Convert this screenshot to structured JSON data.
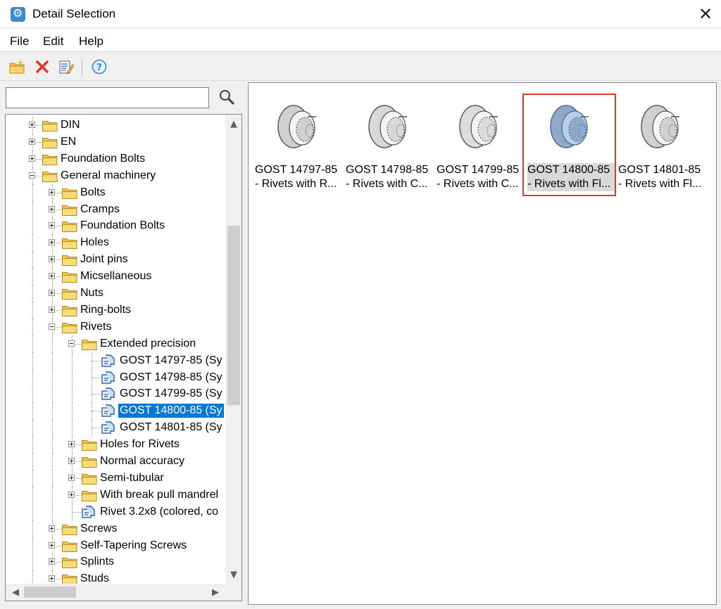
{
  "window": {
    "title": "Detail Selection"
  },
  "menu": [
    "File",
    "Edit",
    "Help"
  ],
  "toolbar": {
    "icons": [
      "new-folder-icon",
      "delete-icon",
      "edit-properties-icon",
      "help-icon"
    ],
    "colors": {
      "delete": "#d9382b",
      "help": "#2f7fd8",
      "folder": "#f3c64a"
    }
  },
  "search": {
    "value": "",
    "placeholder": ""
  },
  "tree": [
    {
      "label": "DIN",
      "level": 1,
      "type": "folder",
      "expander": "plus"
    },
    {
      "label": "EN",
      "level": 1,
      "type": "folder",
      "expander": "plus"
    },
    {
      "label": "Foundation Bolts",
      "level": 1,
      "type": "folder",
      "expander": "plus"
    },
    {
      "label": "General machinery",
      "level": 1,
      "type": "folder",
      "expander": "minus"
    },
    {
      "label": "Bolts",
      "level": 2,
      "type": "folder",
      "expander": "plus"
    },
    {
      "label": "Cramps",
      "level": 2,
      "type": "folder",
      "expander": "plus"
    },
    {
      "label": "Foundation Bolts",
      "level": 2,
      "type": "folder",
      "expander": "plus"
    },
    {
      "label": "Holes",
      "level": 2,
      "type": "folder",
      "expander": "plus"
    },
    {
      "label": "Joint pins",
      "level": 2,
      "type": "folder",
      "expander": "plus"
    },
    {
      "label": "Micsellaneous",
      "level": 2,
      "type": "folder",
      "expander": "plus"
    },
    {
      "label": "Nuts",
      "level": 2,
      "type": "folder",
      "expander": "plus"
    },
    {
      "label": "Ring-bolts",
      "level": 2,
      "type": "folder",
      "expander": "plus"
    },
    {
      "label": "Rivets",
      "level": 2,
      "type": "folder",
      "expander": "minus"
    },
    {
      "label": "Extended precision",
      "level": 3,
      "type": "folder",
      "expander": "minus"
    },
    {
      "label": "GOST 14797-85 (Sy",
      "level": 4,
      "type": "part",
      "expander": ""
    },
    {
      "label": "GOST 14798-85 (Sy",
      "level": 4,
      "type": "part",
      "expander": ""
    },
    {
      "label": "GOST 14799-85 (Sy",
      "level": 4,
      "type": "part",
      "expander": ""
    },
    {
      "label": "GOST 14800-85 (Sy",
      "level": 4,
      "type": "part",
      "expander": "",
      "selected": true
    },
    {
      "label": "GOST 14801-85 (Sy",
      "level": 4,
      "type": "part",
      "expander": ""
    },
    {
      "label": "Holes for Rivets",
      "level": 3,
      "type": "folder",
      "expander": "plus"
    },
    {
      "label": "Normal accuracy",
      "level": 3,
      "type": "folder",
      "expander": "plus"
    },
    {
      "label": "Semi-tubular",
      "level": 3,
      "type": "folder",
      "expander": "plus"
    },
    {
      "label": "With break pull mandrel",
      "level": 3,
      "type": "folder",
      "expander": "plus"
    },
    {
      "label": "Rivet 3.2x8 (colored, co",
      "level": 3,
      "type": "part",
      "expander": ""
    },
    {
      "label": "Screws",
      "level": 2,
      "type": "folder",
      "expander": "plus"
    },
    {
      "label": "Self-Tapering Screws",
      "level": 2,
      "type": "folder",
      "expander": "plus"
    },
    {
      "label": "Splints",
      "level": 2,
      "type": "folder",
      "expander": "plus"
    },
    {
      "label": "Studs",
      "level": 2,
      "type": "folder",
      "expander": "plus"
    }
  ],
  "thumbnails": [
    {
      "title": "GOST 14797-85",
      "subtitle": "- Rivets with R...",
      "selected": false,
      "tint": "#d0d0d0"
    },
    {
      "title": "GOST 14798-85",
      "subtitle": "- Rivets with C...",
      "selected": false,
      "tint": "#d8d8d8"
    },
    {
      "title": "GOST 14799-85",
      "subtitle": "- Rivets with C...",
      "selected": false,
      "tint": "#dcdcdc"
    },
    {
      "title": "GOST 14800-85",
      "subtitle": "- Rivets with Fl...",
      "selected": true,
      "tint": "#8fa9c8"
    },
    {
      "title": "GOST 14801-85",
      "subtitle": "- Rivets with Fl...",
      "selected": false,
      "tint": "#d0d0d0"
    }
  ],
  "scroll_icons": [
    "scroll-up-arrow-icon",
    "scroll-down-arrow-icon",
    "scroll-left-arrow-icon",
    "scroll-right-arrow-icon"
  ]
}
